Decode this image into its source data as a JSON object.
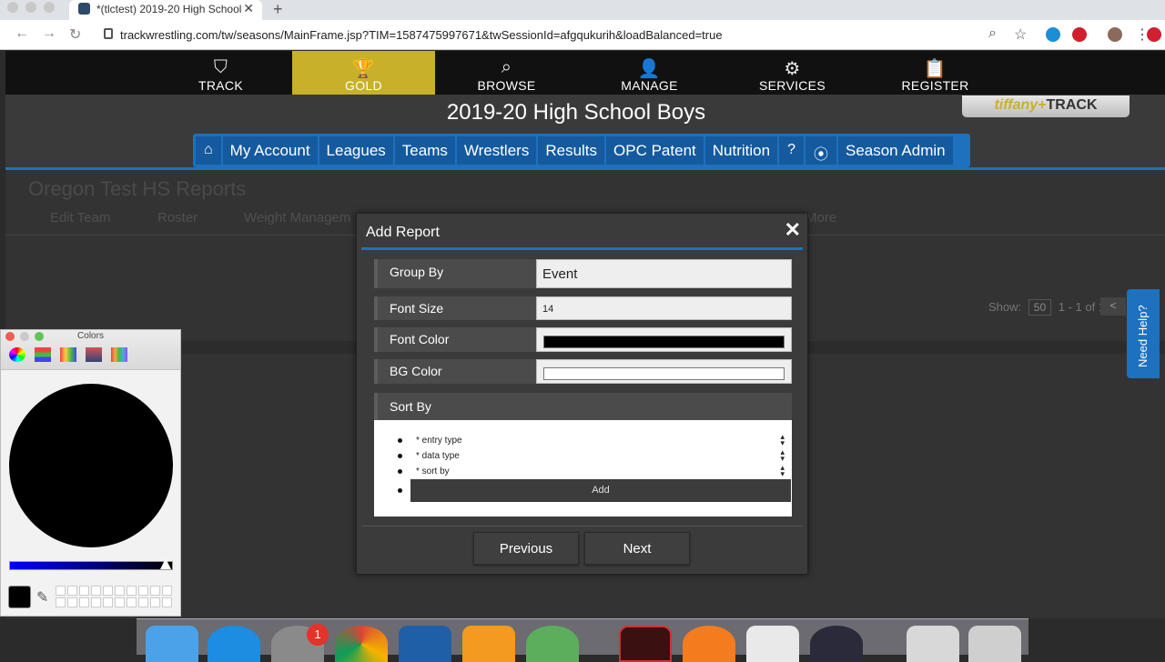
{
  "browser": {
    "tab_title": "*(tlctest) 2019-20 High School",
    "tab_close": "✕",
    "new_tab": "+",
    "url": "trackwrestling.com/tw/seasons/MainFrame.jsp?TIM=1587475997671&twSessionId=afgqukurih&loadBalanced=true"
  },
  "site_nav": [
    {
      "label": "TRACK",
      "icon": "shield-w-icon",
      "glyph": "⛉"
    },
    {
      "label": "GOLD",
      "icon": "trophy-icon",
      "glyph": "🏆"
    },
    {
      "label": "BROWSE",
      "icon": "search-icon",
      "glyph": "⌕"
    },
    {
      "label": "MANAGE",
      "icon": "person-icon",
      "glyph": "👤"
    },
    {
      "label": "SERVICES",
      "icon": "gear-icon",
      "glyph": "⚙"
    },
    {
      "label": "REGISTER",
      "icon": "clipboard-check-icon",
      "glyph": "📋"
    }
  ],
  "season_title": "2019-20 High School Boys",
  "brand": {
    "first": "tiffany+",
    "second": "TRACK"
  },
  "main_menu": {
    "home_glyph": "⌂",
    "items": [
      "My Account",
      "Leagues",
      "Teams",
      "Wrestlers",
      "Results",
      "OPC Patent",
      "Nutrition"
    ],
    "help_glyph": "?",
    "rss_glyph": "⦿",
    "season_admin": "Season Admin"
  },
  "background_page": {
    "title": "Oregon Test HS Reports",
    "links": [
      "Edit Team",
      "Roster",
      "Weight Managem",
      "More"
    ],
    "show_label": "Show:",
    "show_value": "50",
    "range": "1 - 1 of 1",
    "pager_prev": "<"
  },
  "help_tab": "Need Help?",
  "modal": {
    "title": "Add Report",
    "close": "✕",
    "fields": [
      {
        "label": "Group By",
        "value": "Event"
      },
      {
        "label": "Font Size",
        "value": "14"
      },
      {
        "label": "Font Color",
        "color": "#000000"
      },
      {
        "label": "BG Color",
        "color": "#ffffff"
      }
    ],
    "sort_label": "Sort By",
    "sort_options": [
      "* entry type",
      "* data type",
      "* sort by"
    ],
    "add_label": "Add",
    "previous": "Previous",
    "next": "Next"
  },
  "colors_panel": {
    "title": "Colors",
    "selected_color": "#000000"
  },
  "dock": {
    "badge": "1"
  }
}
